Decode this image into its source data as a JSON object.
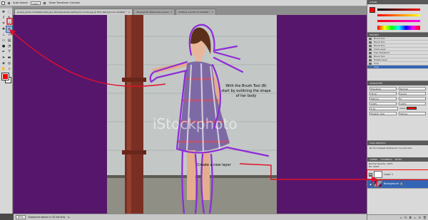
{
  "options_bar": {
    "auto_select_label": "Auto-Select:",
    "auto_select_value": "Layer",
    "transform_label": "Show Transform Controls"
  },
  "tabs": [
    {
      "label": "purple_photo-7124446-pretty-girl-standing-while-waiting-for-a-train.jpg @ 50% (Background, RGB/8) *",
      "active": true
    },
    {
      "label": "iStockphoto Photoshop Layout",
      "active": false
    },
    {
      "label": "Untitled-1 @ 66.7% (RGB/8) *",
      "active": false
    }
  ],
  "watermark": "iStockphoto",
  "annotations": {
    "brush_line1": "With the Brush Tool (B)",
    "brush_line2": "start by outlining the shape",
    "brush_line3": "of her body",
    "new_layer": "Create a new layer"
  },
  "status_bar": {
    "zoom": "50%",
    "info": "Exposure works in 32-bit only"
  },
  "history": {
    "header": "HISTORY",
    "items": [
      {
        "label": "Brush Tool",
        "selected": false
      },
      {
        "label": "Brush Tool",
        "selected": false
      },
      {
        "label": "Brush Tool",
        "selected": false
      },
      {
        "label": "Snap Layer",
        "selected": false
      },
      {
        "label": "Free Transform",
        "selected": false
      },
      {
        "label": "Brush Tool",
        "selected": false
      },
      {
        "label": "Delete Layer",
        "selected": false
      },
      {
        "label": "Crop",
        "selected": false
      },
      {
        "label": "Crop",
        "selected": true
      }
    ]
  },
  "character": {
    "header": "CHARACTER",
    "font": "Helvetica",
    "style": "Normal",
    "size": "38 pt",
    "leading": "(Auto)",
    "kerning": "Metrics",
    "tracking": "0",
    "scale_v": "100%",
    "scale_h": "100%",
    "baseline": "0 pt",
    "color_label": "Color:",
    "language": "English: USA",
    "aa": "Strong"
  },
  "tool_presets": {
    "header": "TOOL PRESETS",
    "text": "No Tool Presets Defined for Current Tool"
  },
  "layers": {
    "tab_layers": "LAYERS",
    "tab_channels": "CHANNELS",
    "tab_paths": "PATHS",
    "blend": "Normal",
    "opacity_label": "Opacity:",
    "opacity": "100%",
    "fill_label": "Fill:",
    "fill": "100%",
    "rows": [
      {
        "label": "Layer 1",
        "selected": false,
        "highlight": true
      },
      {
        "label": "Background",
        "selected": true,
        "highlight": false
      }
    ]
  },
  "colors": {
    "foreground": "#ff0000",
    "background": "#ffffff",
    "canvas": "#56166c",
    "annotation_arrow": "#e0102a",
    "outline": "#8f2ad8"
  }
}
